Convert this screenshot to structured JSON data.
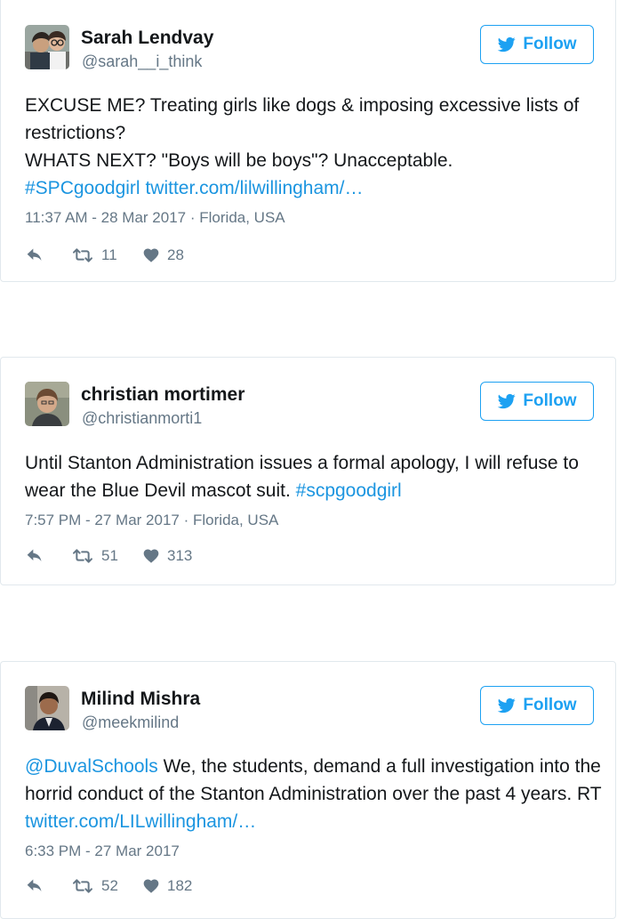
{
  "tweets": [
    {
      "name": "Sarah Lendvay",
      "handle": "@sarah__i_think",
      "follow_label": "Follow",
      "line1": "EXCUSE ME? Treating girls like dogs & imposing excessive lists of restrictions?",
      "line2": "WHATS NEXT? \"Boys will be boys\"? Unacceptable.",
      "hashtag": "#SPCgoodgirl",
      "link": "twitter.com/lilwillingham/…",
      "timestamp": "11:37 AM - 28 Mar 2017",
      "location": "Florida, USA",
      "retweets": "11",
      "likes": "28"
    },
    {
      "name": "christian mortimer",
      "handle": "@christianmorti1",
      "follow_label": "Follow",
      "text": "Until Stanton Administration issues a formal apology, I will refuse to wear the Blue Devil mascot suit.",
      "hashtag": "#scpgoodgirl",
      "timestamp": "7:57 PM - 27 Mar 2017",
      "location": "Florida, USA",
      "retweets": "51",
      "likes": "313"
    },
    {
      "name": "Milind Mishra",
      "handle": "@meekmilind",
      "follow_label": "Follow",
      "mention": "@DuvalSchools",
      "text": "We, the students, demand a full investigation into the horrid conduct of the Stanton Administration over the past 4 years. RT",
      "link": "twitter.com/LILwillingham/…",
      "timestamp": "6:33 PM - 27 Mar 2017",
      "retweets": "52",
      "likes": "182"
    }
  ],
  "separator": "·",
  "colors": {
    "link": "#1b95e0",
    "follow": "#1da1f2",
    "muted": "#657786",
    "border": "#e1e8ed"
  }
}
